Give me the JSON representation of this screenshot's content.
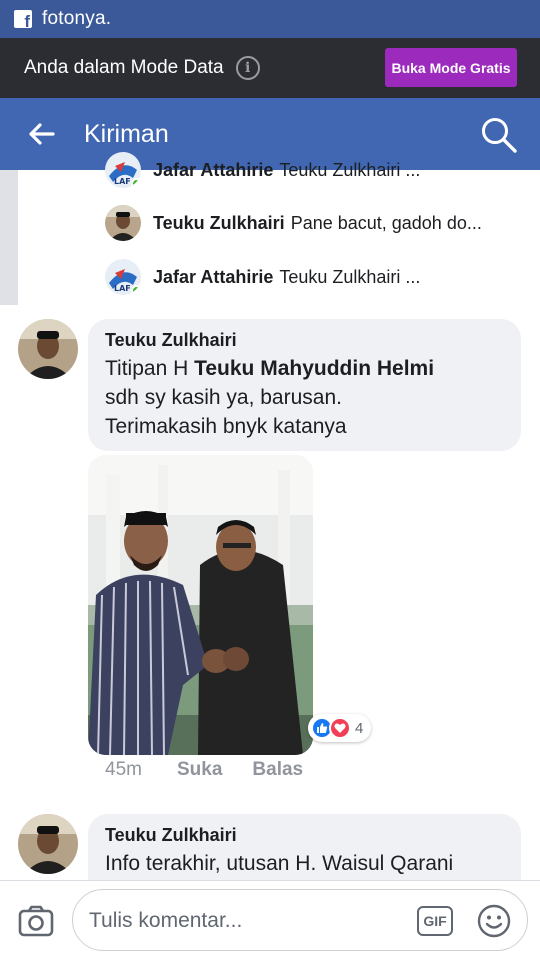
{
  "status_bar": {
    "title": "fotonya."
  },
  "data_mode": {
    "text": "Anda dalam Mode Data",
    "button_label": "Buka Mode Gratis"
  },
  "header": {
    "title": "Kiriman"
  },
  "replies": [
    {
      "name": "Jafar Attahirie",
      "text": "Teuku Zulkhairi ..."
    },
    {
      "name": "Teuku Zulkhairi",
      "text": "Pane bacut, gadoh do..."
    },
    {
      "name": "Jafar Attahirie",
      "text": "Teuku Zulkhairi ..."
    }
  ],
  "comment1": {
    "author": "Teuku Zulkhairi",
    "text_before": "Titipan H ",
    "text_bold": "Teuku Mahyuddin Helmi",
    "line2": "sdh sy kasih ya, barusan.",
    "line3": "Terimakasih bnyk katanya",
    "reaction_count": "4",
    "time": "45m",
    "like_label": "Suka",
    "reply_label": "Balas"
  },
  "comment2": {
    "author": "Teuku Zulkhairi",
    "text": "Info terakhir, utusan H. Waisul Qarani"
  },
  "composer": {
    "placeholder": "Tulis komentar...",
    "gif_label": "GIF"
  },
  "colors": {
    "status_bar": "#3b5998",
    "mode_bar": "#2b2d33",
    "header": "#4267b2",
    "free_button": "#9c2bbd",
    "bubble": "#f0f1f4"
  }
}
